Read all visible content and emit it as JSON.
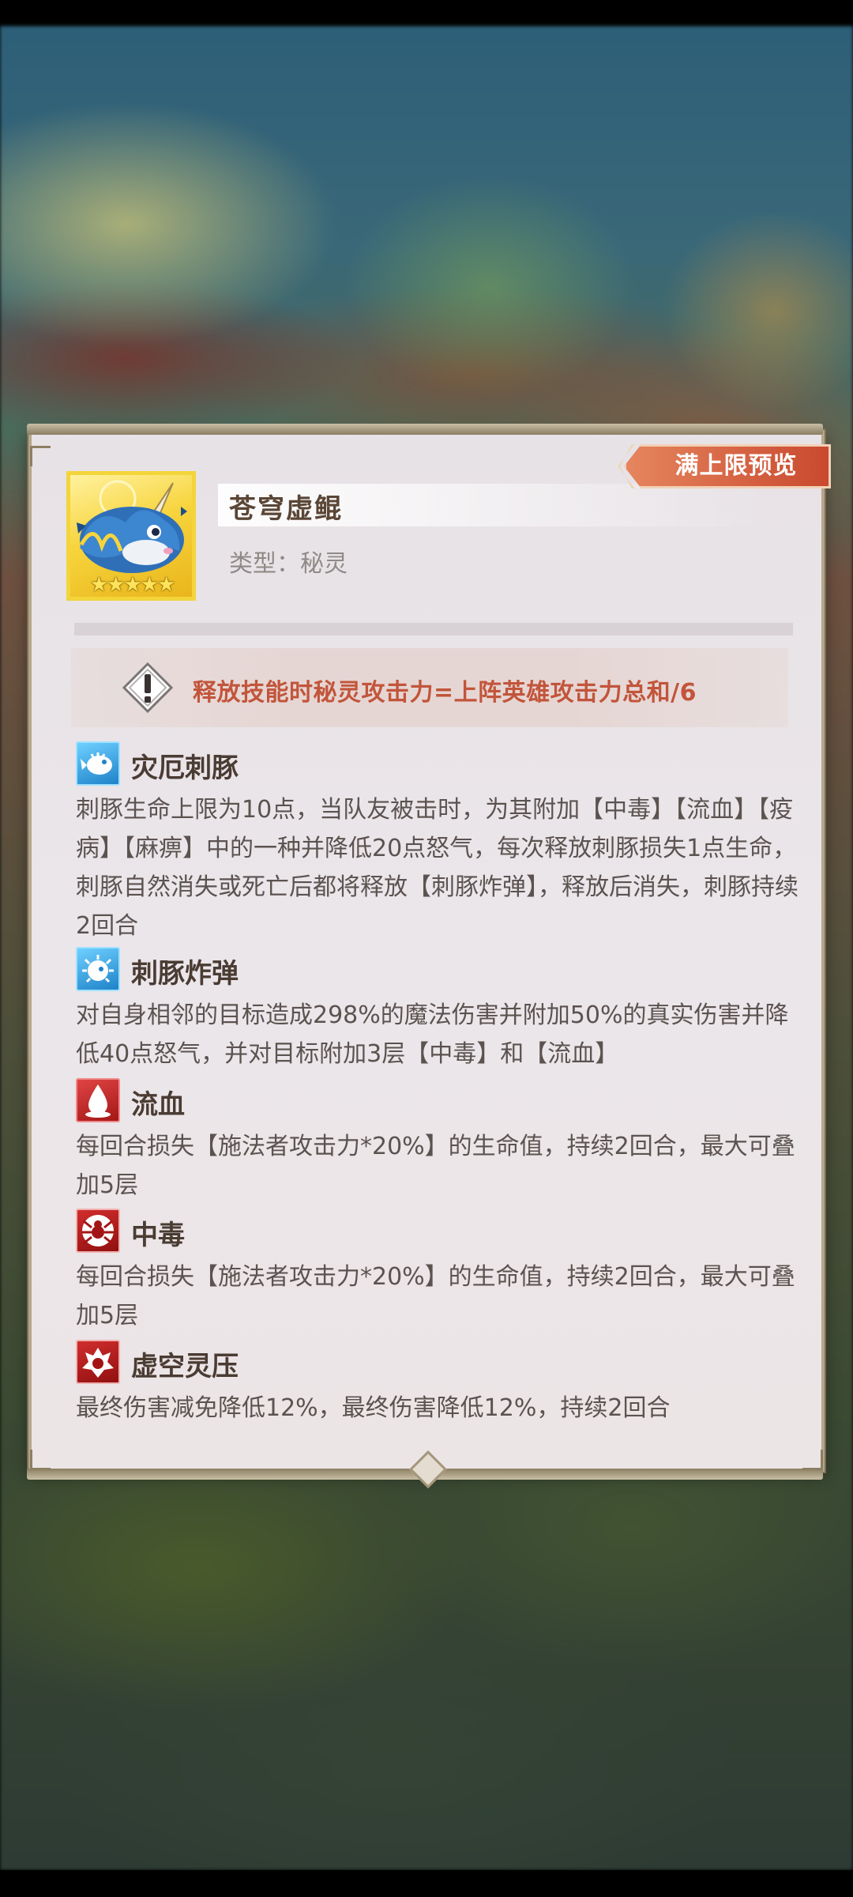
{
  "hero": {
    "name": "苍穹虚鲲",
    "type_label": "类型：秘灵",
    "stars": "★★★★★",
    "max_preview_label": "满上限预览"
  },
  "warning": {
    "text": "释放技能时秘灵攻击力=上阵英雄攻击力总和/6"
  },
  "skills": [
    {
      "title": "灾厄刺豚",
      "icon": "pufferfish-icon",
      "desc": "刺豚生命上限为10点，当队友被击时，为其附加【中毒】【流血】【疫病】【麻痹】中的一种并降低20点怒气，每次释放刺豚损失1点生命，刺豚自然消失或死亡后都将释放【刺豚炸弹】，释放后消失，刺豚持续2回合"
    },
    {
      "title": "刺豚炸弹",
      "icon": "puffer-bomb-icon",
      "desc": "对自身相邻的目标造成298%的魔法伤害并附加50%的真实伤害并降低40点怒气，并对目标附加3层【中毒】和【流血】"
    },
    {
      "title": "流血",
      "icon": "blood-drop-icon",
      "desc": "每回合损失【施法者攻击力*20%】的生命值，持续2回合，最大可叠加5层"
    },
    {
      "title": "中毒",
      "icon": "poison-spider-icon",
      "desc": "每回合损失【施法者攻击力*20%】的生命值，持续2回合，最大可叠加5层"
    },
    {
      "title": "虚空灵压",
      "icon": "void-pressure-icon",
      "desc": "最终伤害减免降低12%，最终伤害降低12%，持续2回合"
    }
  ],
  "colors": {
    "warning_text": "#c2553b",
    "preview_button": "#d6603f",
    "title_text": "#4a3c33",
    "desc_text": "#5b5350"
  }
}
